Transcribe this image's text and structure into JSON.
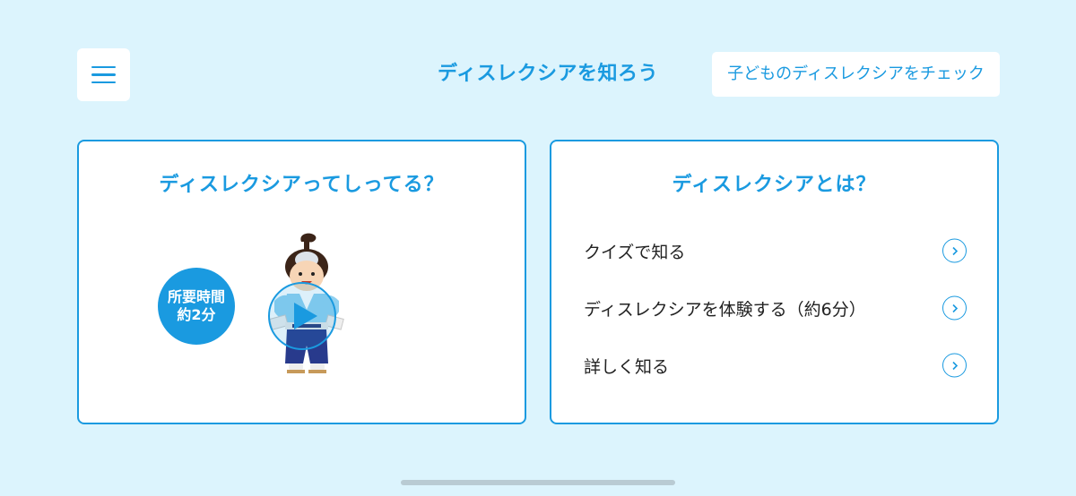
{
  "header": {
    "menu_icon": "hamburger-menu-icon",
    "title": "ディスレクシアを知ろう",
    "check_button_label": "子どものディスレクシアをチェック"
  },
  "video_card": {
    "title": "ディスレクシアってしってる？",
    "duration_line1": "所要時間",
    "duration_line2": "約2分",
    "character_image": "samurai-character",
    "play_icon": "play-icon"
  },
  "info_card": {
    "title": "ディスレクシアとは？",
    "items": [
      {
        "label": "クイズで知る",
        "icon": "chevron-right-circle-icon"
      },
      {
        "label": "ディスレクシアを体験する（約6分）",
        "icon": "chevron-right-circle-icon"
      },
      {
        "label": "詳しく知る",
        "icon": "chevron-right-circle-icon"
      }
    ]
  },
  "colors": {
    "background": "#dcf4fd",
    "accent": "#1a9ae0",
    "card": "#ffffff",
    "text": "#222222"
  }
}
